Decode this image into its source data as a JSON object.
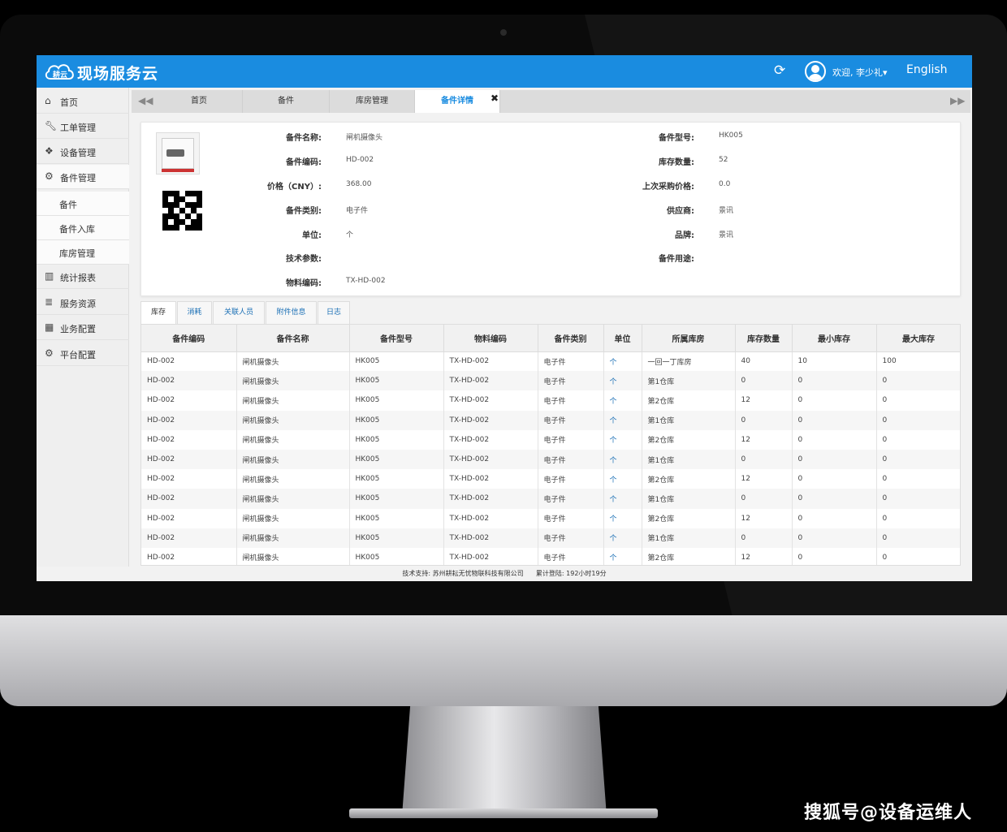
{
  "app": {
    "logo_text": "耕云",
    "title": "现场服务云"
  },
  "header": {
    "welcome": "欢迎, 李少礼▾",
    "language": "English"
  },
  "sidebar": {
    "items": [
      {
        "label": "首页",
        "icon": "home-icon"
      },
      {
        "label": "工单管理",
        "icon": "wrench-icon"
      },
      {
        "label": "设备管理",
        "icon": "cubes-icon"
      },
      {
        "label": "备件管理",
        "icon": "cogs-icon"
      },
      {
        "label": "备件"
      },
      {
        "label": "备件入库"
      },
      {
        "label": "库房管理"
      },
      {
        "label": "统计报表",
        "icon": "bar-chart-icon"
      },
      {
        "label": "服务资源",
        "icon": "database-icon"
      },
      {
        "label": "业务配置",
        "icon": "building-icon"
      },
      {
        "label": "平台配置",
        "icon": "gear-icon"
      }
    ]
  },
  "tabs": [
    {
      "label": "首页"
    },
    {
      "label": "备件"
    },
    {
      "label": "库房管理"
    },
    {
      "label": "备件详情"
    }
  ],
  "detail": {
    "left": [
      {
        "label": "备件名称:",
        "value": "闸机摄像头"
      },
      {
        "label": "备件编码:",
        "value": "HD-002"
      },
      {
        "label": "价格（CNY）:",
        "value": "368.00"
      },
      {
        "label": "备件类别:",
        "value": "电子件"
      },
      {
        "label": "单位:",
        "value": "个"
      },
      {
        "label": "技术参数:",
        "value": ""
      },
      {
        "label": "物料编码:",
        "value": "TX-HD-002"
      }
    ],
    "right": [
      {
        "label": "备件型号:",
        "value": "HK005"
      },
      {
        "label": "库存数量:",
        "value": "52"
      },
      {
        "label": "上次采购价格:",
        "value": "0.0"
      },
      {
        "label": "供应商:",
        "value": "景讯"
      },
      {
        "label": "品牌:",
        "value": "景讯"
      },
      {
        "label": "备件用途:",
        "value": ""
      }
    ]
  },
  "subtabs": [
    {
      "label": "库存"
    },
    {
      "label": "消耗"
    },
    {
      "label": "关联人员"
    },
    {
      "label": "附件信息"
    },
    {
      "label": "日志"
    }
  ],
  "table": {
    "columns": [
      "备件编码",
      "备件名称",
      "备件型号",
      "物料编码",
      "备件类别",
      "单位",
      "所属库房",
      "库存数量",
      "最小库存",
      "最大库存"
    ],
    "rows": [
      [
        "HD-002",
        "闸机摄像头",
        "HK005",
        "TX-HD-002",
        "电子件",
        "个",
        "一回一丁库房",
        "40",
        "10",
        "100"
      ],
      [
        "HD-002",
        "闸机摄像头",
        "HK005",
        "TX-HD-002",
        "电子件",
        "个",
        "第1仓库",
        "0",
        "0",
        "0"
      ],
      [
        "HD-002",
        "闸机摄像头",
        "HK005",
        "TX-HD-002",
        "电子件",
        "个",
        "第2仓库",
        "12",
        "0",
        "0"
      ],
      [
        "HD-002",
        "闸机摄像头",
        "HK005",
        "TX-HD-002",
        "电子件",
        "个",
        "第1仓库",
        "0",
        "0",
        "0"
      ],
      [
        "HD-002",
        "闸机摄像头",
        "HK005",
        "TX-HD-002",
        "电子件",
        "个",
        "第2仓库",
        "12",
        "0",
        "0"
      ],
      [
        "HD-002",
        "闸机摄像头",
        "HK005",
        "TX-HD-002",
        "电子件",
        "个",
        "第1仓库",
        "0",
        "0",
        "0"
      ],
      [
        "HD-002",
        "闸机摄像头",
        "HK005",
        "TX-HD-002",
        "电子件",
        "个",
        "第2仓库",
        "12",
        "0",
        "0"
      ],
      [
        "HD-002",
        "闸机摄像头",
        "HK005",
        "TX-HD-002",
        "电子件",
        "个",
        "第1仓库",
        "0",
        "0",
        "0"
      ],
      [
        "HD-002",
        "闸机摄像头",
        "HK005",
        "TX-HD-002",
        "电子件",
        "个",
        "第2仓库",
        "12",
        "0",
        "0"
      ],
      [
        "HD-002",
        "闸机摄像头",
        "HK005",
        "TX-HD-002",
        "电子件",
        "个",
        "第1仓库",
        "0",
        "0",
        "0"
      ],
      [
        "HD-002",
        "闸机摄像头",
        "HK005",
        "TX-HD-002",
        "电子件",
        "个",
        "第2仓库",
        "12",
        "0",
        "0"
      ]
    ]
  },
  "footer": {
    "support": "技术支持: 苏州耕耘无忧物联科技有限公司",
    "uptime": "累计登陆: 192小时19分"
  },
  "watermark": "搜狐号@设备运维人",
  "colors": {
    "accent": "#1a8ce0",
    "link": "#1a6fb5",
    "header_bg": "#f1f1f1"
  }
}
